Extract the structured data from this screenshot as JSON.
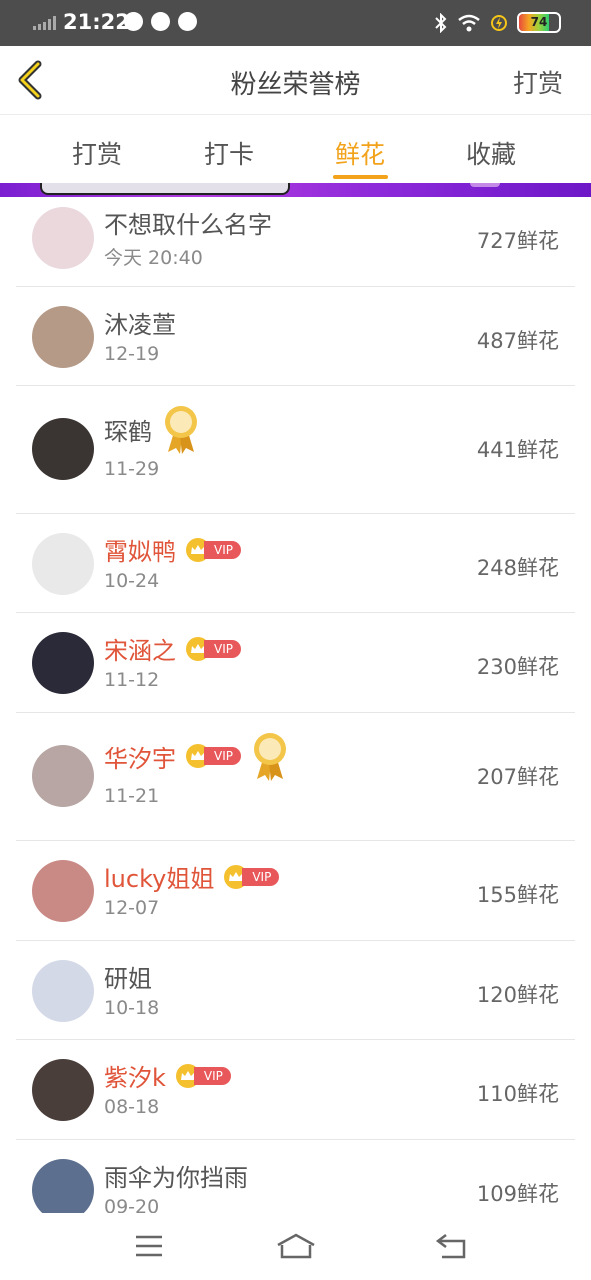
{
  "status_bar": {
    "time": "21:22",
    "battery": "74"
  },
  "header": {
    "title": "粉丝荣誉榜",
    "action_label": "打赏"
  },
  "tabs": [
    {
      "label": "打赏"
    },
    {
      "label": "打卡"
    },
    {
      "label": "鲜花",
      "active": true
    },
    {
      "label": "收藏"
    }
  ],
  "fans": [
    {
      "name": "不想取什么名字",
      "date": "今天 20:40",
      "count": "727鲜花",
      "vip": false,
      "medal": "",
      "avatar_color": "#ead8dd"
    },
    {
      "name": "沐凌萱",
      "date": "12-19",
      "count": "487鲜花",
      "vip": false,
      "medal": "",
      "avatar_color": "#b59a88"
    },
    {
      "name": "琛鹤",
      "date": "11-29",
      "count": "441鲜花",
      "vip": false,
      "medal": "LV1",
      "avatar_color": "#3a3533"
    },
    {
      "name": "霄姒鸭",
      "date": "10-24",
      "count": "248鲜花",
      "vip": true,
      "medal": "",
      "avatar_color": "#e9e9e9"
    },
    {
      "name": "宋涵之",
      "date": "11-12",
      "count": "230鲜花",
      "vip": true,
      "medal": "",
      "avatar_color": "#2b2a38"
    },
    {
      "name": "华汐宇",
      "date": "11-21",
      "count": "207鲜花",
      "vip": true,
      "medal": "LV2",
      "avatar_color": "#b7a6a3"
    },
    {
      "name": "lucky姐姐",
      "date": "12-07",
      "count": "155鲜花",
      "vip": true,
      "medal": "",
      "avatar_color": "#c98a86"
    },
    {
      "name": "研姐",
      "date": "10-18",
      "count": "120鲜花",
      "vip": false,
      "medal": "",
      "avatar_color": "#d4d9e8"
    },
    {
      "name": "紫汐k",
      "date": "08-18",
      "count": "110鲜花",
      "vip": true,
      "medal": "",
      "avatar_color": "#4a3e3b"
    },
    {
      "name": "雨伞为你挡雨",
      "date": "09-20",
      "count": "109鲜花",
      "vip": false,
      "medal": "",
      "avatar_color": "#5d6f8e"
    }
  ],
  "vip_label": "VIP",
  "colors": {
    "accent": "#f2a31b",
    "vip_name": "#e0553a",
    "banner": "#8a28d9"
  }
}
